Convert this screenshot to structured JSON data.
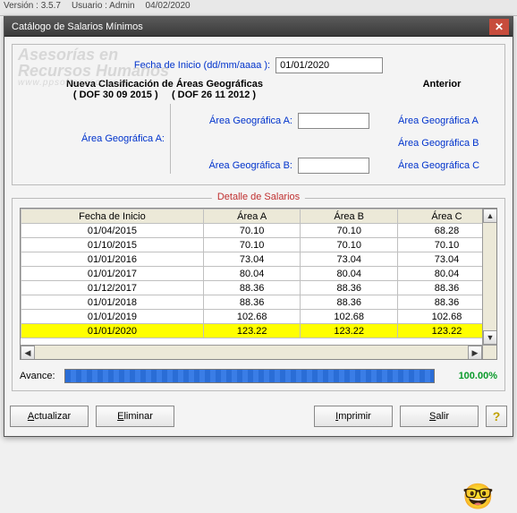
{
  "topbar": {
    "version_label": "Versión : 3.5.7",
    "user_label": "Usuario : Admin",
    "date": "04/02/2020"
  },
  "window": {
    "title": "Catálogo de Salarios Mínimos"
  },
  "form": {
    "fecha_inicio_label": "Fecha de Inicio (dd/mm/aaaa ):",
    "fecha_inicio_value": "01/01/2020",
    "nueva_clasif": "Nueva Clasificación de Áreas Geográficas",
    "dof1": "( DOF 30 09 2015 )",
    "dof2": "( DOF 26 11 2012 )",
    "anterior": "Anterior",
    "area_a_left": "Área Geográfica A:",
    "area_a_mid": "Área Geográfica A:",
    "area_b_mid": "Área Geográfica B:",
    "links": {
      "a": "Área Geográfica A",
      "b": "Área Geográfica B",
      "c": "Área Geográfica C"
    }
  },
  "detail": {
    "title": "Detalle de Salarios",
    "headers": {
      "fecha": "Fecha de Inicio",
      "a": "Área A",
      "b": "Área B",
      "c": "Área C"
    },
    "rows": [
      {
        "fecha": "01/04/2015",
        "a": "70.10",
        "b": "70.10",
        "c": "68.28"
      },
      {
        "fecha": "01/10/2015",
        "a": "70.10",
        "b": "70.10",
        "c": "70.10"
      },
      {
        "fecha": "01/01/2016",
        "a": "73.04",
        "b": "73.04",
        "c": "73.04"
      },
      {
        "fecha": "01/01/2017",
        "a": "80.04",
        "b": "80.04",
        "c": "80.04"
      },
      {
        "fecha": "01/12/2017",
        "a": "88.36",
        "b": "88.36",
        "c": "88.36"
      },
      {
        "fecha": "01/01/2018",
        "a": "88.36",
        "b": "88.36",
        "c": "88.36"
      },
      {
        "fecha": "01/01/2019",
        "a": "102.68",
        "b": "102.68",
        "c": "102.68"
      },
      {
        "fecha": "01/01/2020",
        "a": "123.22",
        "b": "123.22",
        "c": "123.22",
        "highlight": true
      }
    ]
  },
  "progress": {
    "label": "Avance:",
    "percent": "100.00%"
  },
  "buttons": {
    "actualizar": "Actualizar",
    "eliminar": "Eliminar",
    "imprimir": "Imprimir",
    "salir": "Salir"
  },
  "watermark": {
    "line1": "Asesorías en",
    "line2": "Recursos Humanos",
    "url": "www.ppsoftasesor.com"
  }
}
